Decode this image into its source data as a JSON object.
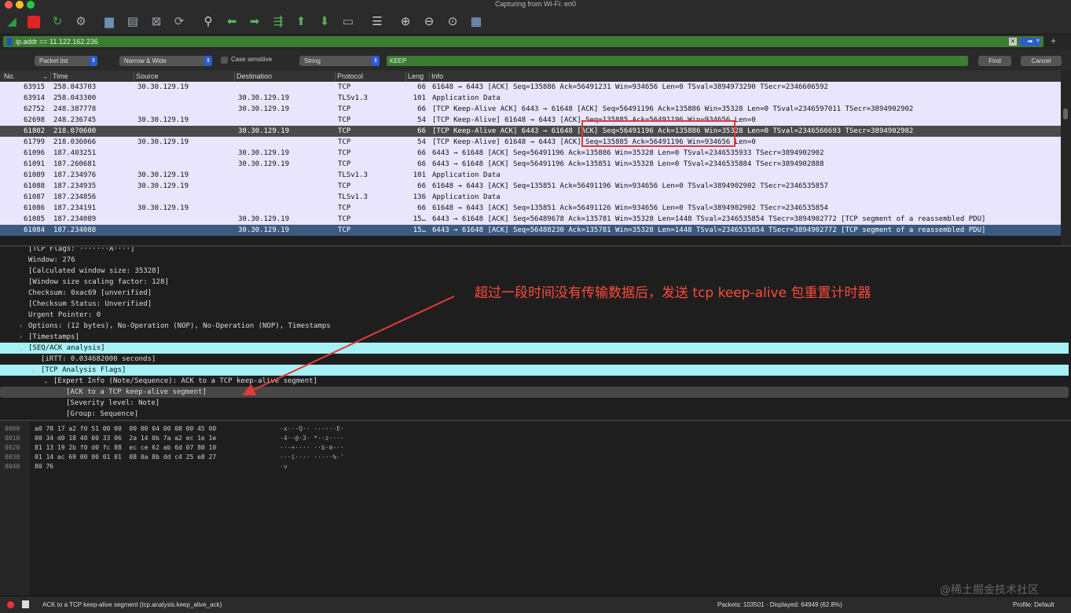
{
  "window": {
    "title": "Capturing from Wi-Fi: en0"
  },
  "filter": {
    "value": "ip.addr == 11.122.162.236"
  },
  "find_bar": {
    "search_in": "Packet list",
    "char_width": "Narrow & Wide",
    "case_sensitive_label": "Case sensitive",
    "search_type": "String",
    "query": "KEEP",
    "find_label": "Find",
    "cancel_label": "Cancel"
  },
  "columns": [
    "No.",
    "Time",
    "Source",
    "Destination",
    "Protocol",
    "Leng",
    "Info"
  ],
  "packets": [
    {
      "no": "63915",
      "time": "258.043703",
      "source": "30.30.129.19",
      "destination": "",
      "protocol": "TCP",
      "length": "66",
      "info": "61648 → 6443 [ACK] Seq=135886 Ack=56491231 Win=934656 Len=0 TSval=3894973290 TSecr=2346606592"
    },
    {
      "no": "63914",
      "time": "258.043300",
      "source": "",
      "destination": "30.30.129.19",
      "protocol": "TLSv1.3",
      "length": "101",
      "info": "Application Data"
    },
    {
      "no": "62752",
      "time": "248.387778",
      "source": "",
      "destination": "30.30.129.19",
      "protocol": "TCP",
      "length": "66",
      "info": "[TCP Keep-Alive ACK] 6443 → 61648 [ACK] Seq=56491196 Ack=135886 Win=35328 Len=0 TSval=2346597011 TSecr=3894902902"
    },
    {
      "no": "62698",
      "time": "248.236745",
      "source": "30.30.129.19",
      "destination": "",
      "protocol": "TCP",
      "length": "54",
      "info": "[TCP Keep-Alive] 61648 → 6443 [ACK] Seq=135885 Ack=56491196 Win=934656 Len=0"
    },
    {
      "no": "61802",
      "time": "218.070600",
      "source": "",
      "destination": "30.30.129.19",
      "protocol": "TCP",
      "length": "66",
      "info": "[TCP Keep-Alive ACK] 6443 → 61648 [ACK] Seq=56491196 Ack=135886 Win=35328 Len=0 TSval=2346566693 TSecr=3894902902"
    },
    {
      "no": "61799",
      "time": "218.036066",
      "source": "30.30.129.19",
      "destination": "",
      "protocol": "TCP",
      "length": "54",
      "info": "[TCP Keep-Alive] 61648 → 6443 [ACK] Seq=135885 Ack=56491196 Win=934656 Len=0"
    },
    {
      "no": "61096",
      "time": "187.403251",
      "source": "",
      "destination": "30.30.129.19",
      "protocol": "TCP",
      "length": "66",
      "info": "6443 → 61648 [ACK] Seq=56491196 Ack=135886 Win=35328 Len=0 TSval=2346535933 TSecr=3894902902"
    },
    {
      "no": "61091",
      "time": "187.260681",
      "source": "",
      "destination": "30.30.129.19",
      "protocol": "TCP",
      "length": "66",
      "info": "6443 → 61648 [ACK] Seq=56491196 Ack=135851 Win=35328 Len=0 TSval=2346535884 TSecr=3894902888"
    },
    {
      "no": "61089",
      "time": "187.234976",
      "source": "30.30.129.19",
      "destination": "",
      "protocol": "TLSv1.3",
      "length": "101",
      "info": "Application Data"
    },
    {
      "no": "61088",
      "time": "187.234935",
      "source": "30.30.129.19",
      "destination": "",
      "protocol": "TCP",
      "length": "66",
      "info": "61648 → 6443 [ACK] Seq=135851 Ack=56491196 Win=934656 Len=0 TSval=3894902902 TSecr=2346535857"
    },
    {
      "no": "61087",
      "time": "187.234856",
      "source": "",
      "destination": "",
      "protocol": "TLSv1.3",
      "length": "136",
      "info": "Application Data"
    },
    {
      "no": "61086",
      "time": "187.234191",
      "source": "30.30.129.19",
      "destination": "",
      "protocol": "TCP",
      "length": "66",
      "info": "61648 → 6443 [ACK] Seq=135851 Ack=56491126 Win=934656 Len=0 TSval=3894902902 TSecr=2346535854"
    },
    {
      "no": "61085",
      "time": "187.234089",
      "source": "",
      "destination": "30.30.129.19",
      "protocol": "TCP",
      "length": "15…",
      "info": "6443 → 61648 [ACK] Seq=56489678 Ack=135781 Win=35328 Len=1448 TSval=2346535854 TSecr=3894902772 [TCP segment of a reassembled PDU]"
    },
    {
      "no": "61084",
      "time": "187.234088",
      "source": "",
      "destination": "30.30.129.19",
      "protocol": "TCP",
      "length": "15…",
      "info": "6443 → 61648 [ACK] Seq=56488230 Ack=135781 Win=35328 Len=1448 TSval=2346535854 TSecr=3894902772 [TCP segment of a reassembled PDU]"
    }
  ],
  "details": [
    {
      "indent": 2,
      "toggle": "",
      "text": "[TCP Flags: ·······A····]"
    },
    {
      "indent": 2,
      "toggle": "",
      "text": "Window: 276"
    },
    {
      "indent": 2,
      "toggle": "",
      "text": "[Calculated window size: 35328]"
    },
    {
      "indent": 2,
      "toggle": "",
      "text": "[Window size scaling factor: 128]"
    },
    {
      "indent": 2,
      "toggle": "",
      "text": "Checksum: 0xac69 [unverified]"
    },
    {
      "indent": 2,
      "toggle": "",
      "text": "[Checksum Status: Unverified]"
    },
    {
      "indent": 2,
      "toggle": "",
      "text": "Urgent Pointer: 0"
    },
    {
      "indent": 2,
      "toggle": "›",
      "text": "Options: (12 bytes), No-Operation (NOP), No-Operation (NOP), Timestamps"
    },
    {
      "indent": 2,
      "toggle": "›",
      "text": "[Timestamps]"
    },
    {
      "indent": 2,
      "toggle": "⌄",
      "text": "[SEQ/ACK analysis]",
      "style": "hl"
    },
    {
      "indent": 3,
      "toggle": "",
      "text": "[iRTT: 0.034682000 seconds]"
    },
    {
      "indent": 3,
      "toggle": "⌄",
      "text": "[TCP Analysis Flags]",
      "style": "hl"
    },
    {
      "indent": 4,
      "toggle": "⌄",
      "text": "[Expert Info (Note/Sequence): ACK to a TCP keep-alive segment]"
    },
    {
      "indent": 5,
      "toggle": "",
      "text": "[ACK to a TCP keep-alive segment]",
      "style": "sel"
    },
    {
      "indent": 5,
      "toggle": "",
      "text": "[Severity level: Note]"
    },
    {
      "indent": 5,
      "toggle": "",
      "text": "[Group: Sequence]"
    }
  ],
  "annotation": "超过一段时间没有传输数据后，发送 tcp keep-alive 包重置计时器",
  "bytes": [
    {
      "offset": "0000",
      "hex": "a0 78 17 a2 f0 51 00 00  00 00 04 00 08 00 45 00",
      "ascii": "·x···Q·· ······E·"
    },
    {
      "offset": "0010",
      "hex": "00 34 d0 18 40 00 33 06  2a 14 0b 7a a2 ec 1e 1e",
      "ascii": "·4··@·3· *··z····"
    },
    {
      "offset": "0020",
      "hex": "81 13 19 2b f0 d0 fc 88  ec ce 62 ab 6d 07 80 10",
      "ascii": "···+···· ··b·m···"
    },
    {
      "offset": "0030",
      "hex": "01 14 ac 69 00 00 01 01  08 0a 8b dd c4 25 e8 27",
      "ascii": "···i···· ·····%·'"
    },
    {
      "offset": "0040",
      "hex": "80 76",
      "ascii": "·v"
    }
  ],
  "watermark": "@稀土掘金技术社区",
  "status": {
    "expert_text": "ACK to a TCP keep-alive segment (tcp.analysis.keep_alive_ack)",
    "packets": "Packets: 103501 · Displayed: 64949 (62.8%)",
    "profile": "Profile: Default"
  },
  "colors": {
    "row_purple": "#e8e5fc",
    "row_selected": "#3d5a80",
    "row_dark": "#4a4a4a",
    "highlight_cyan": "#a6f1f5",
    "annotation_red": "#ff4a3a",
    "filter_green": "#3c7c33"
  },
  "icons": {
    "toolbar": [
      "shark-fin-start-icon",
      "stop-capture-icon",
      "restart-capture-icon",
      "capture-options-icon",
      "open-file-icon",
      "save-file-icon",
      "close-file-icon",
      "reload-file-icon",
      "search-packet-icon",
      "go-back-icon",
      "go-forward-icon",
      "go-to-packet-icon",
      "go-to-first-icon",
      "go-to-last-icon",
      "auto-scroll-icon",
      "colorize-icon",
      "zoom-in-icon",
      "zoom-out-icon",
      "zoom-reset-icon",
      "resize-columns-icon"
    ]
  }
}
